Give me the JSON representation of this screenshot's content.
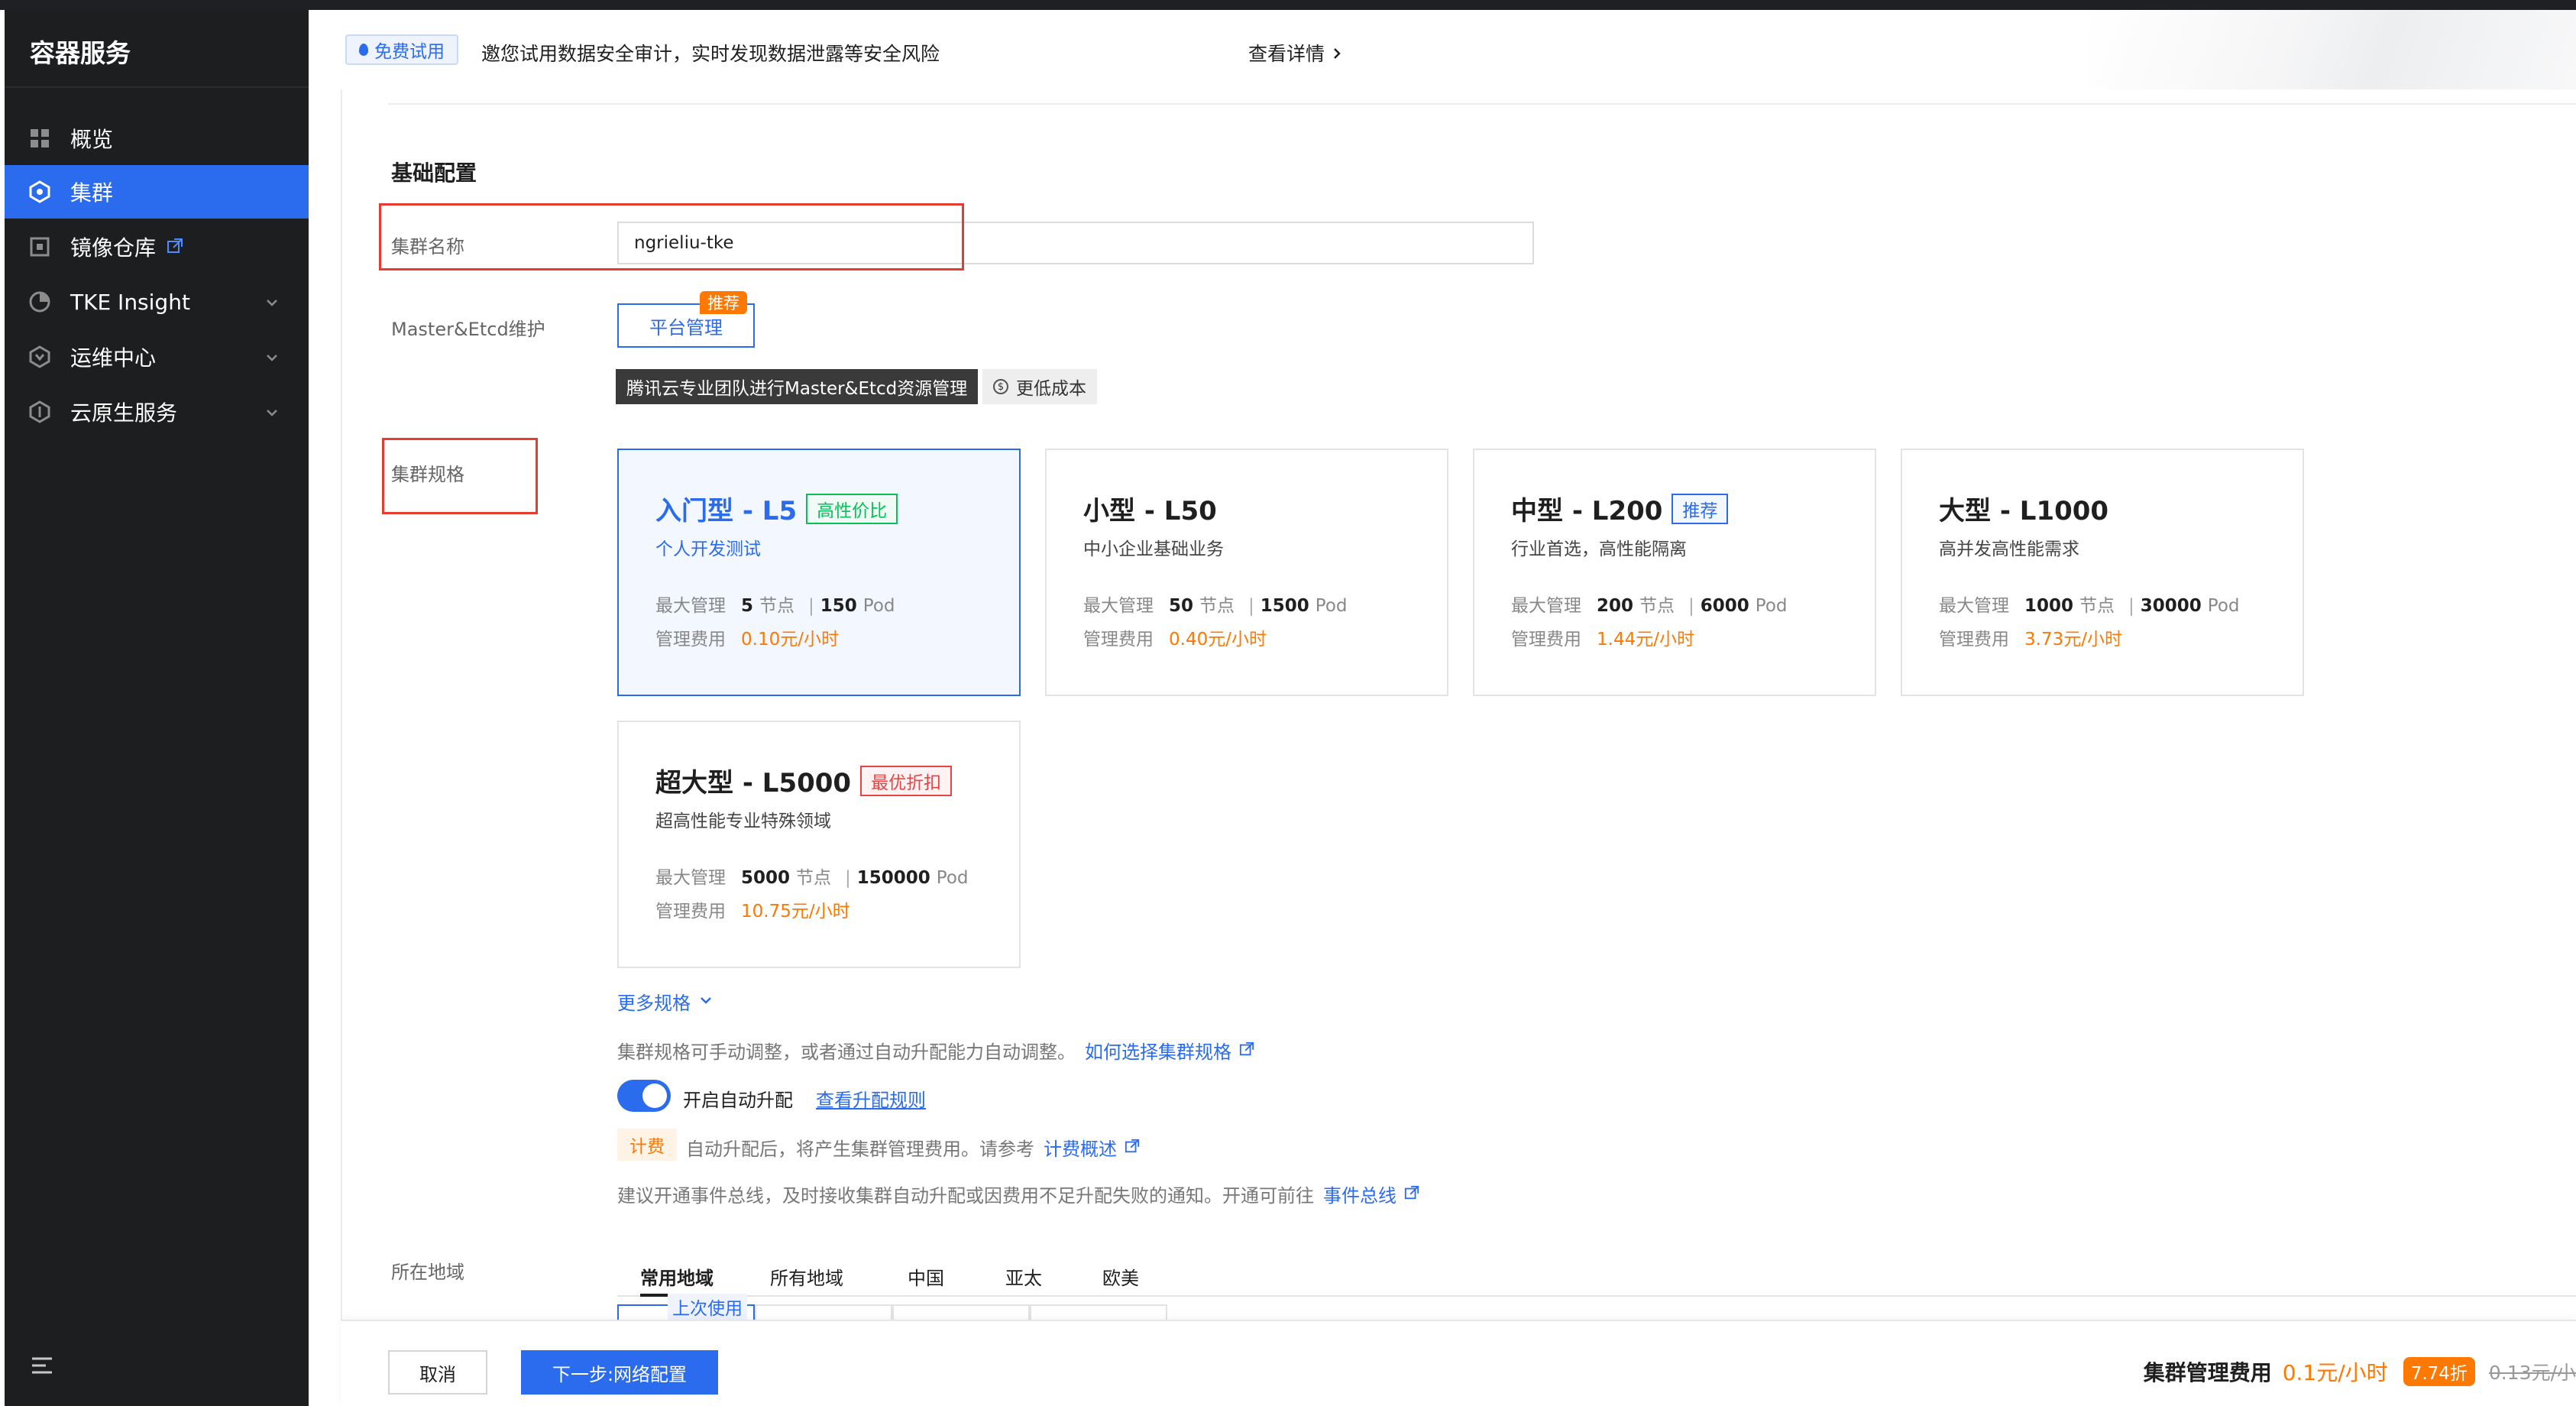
{
  "sidebar": {
    "title": "容器服务",
    "items": [
      {
        "label": "概览",
        "icon": "grid-icon"
      },
      {
        "label": "集群",
        "icon": "cluster-icon"
      },
      {
        "label": "镜像仓库",
        "icon": "image-repo-icon"
      },
      {
        "label": "TKE Insight",
        "icon": "insight-icon"
      },
      {
        "label": "运维中心",
        "icon": "ops-icon"
      },
      {
        "label": "云原生服务",
        "icon": "cloud-native-icon"
      }
    ]
  },
  "banner": {
    "badge": "免费试用",
    "text": "邀您试用数据安全审计，实时发现数据泄露等安全风险",
    "link": "查看详情"
  },
  "form": {
    "section_title": "基础配置",
    "cluster_name_label": "集群名称",
    "cluster_name_value": "ngrieliu-tke",
    "master_label": "Master&Etcd维护",
    "platform_button": "平台管理",
    "recommend_badge": "推荐",
    "tip_dark": "腾讯云专业团队进行Master&Etcd资源管理",
    "tip_light": "更低成本",
    "spec_label": "集群规格",
    "specs": [
      {
        "title": "入门型 - L5",
        "tag": "高性价比",
        "desc": "个人开发测试",
        "mgmt_label": "最大管理",
        "nodes": "5",
        "node_unit": "节点",
        "pods": "150",
        "pod_unit": "Pod",
        "fee_label": "管理费用",
        "price": "0.10元/小时"
      },
      {
        "title": "小型 - L50",
        "tag": "",
        "desc": "中小企业基础业务",
        "mgmt_label": "最大管理",
        "nodes": "50",
        "node_unit": "节点",
        "pods": "1500",
        "pod_unit": "Pod",
        "fee_label": "管理费用",
        "price": "0.40元/小时"
      },
      {
        "title": "中型 - L200",
        "tag": "推荐",
        "desc": "行业首选，高性能隔离",
        "mgmt_label": "最大管理",
        "nodes": "200",
        "node_unit": "节点",
        "pods": "6000",
        "pod_unit": "Pod",
        "fee_label": "管理费用",
        "price": "1.44元/小时"
      },
      {
        "title": "大型 - L1000",
        "tag": "",
        "desc": "高并发高性能需求",
        "mgmt_label": "最大管理",
        "nodes": "1000",
        "node_unit": "节点",
        "pods": "30000",
        "pod_unit": "Pod",
        "fee_label": "管理费用",
        "price": "3.73元/小时"
      },
      {
        "title": "超大型 - L5000",
        "tag": "最优折扣",
        "desc": "超高性能专业特殊领域",
        "mgmt_label": "最大管理",
        "nodes": "5000",
        "node_unit": "节点",
        "pods": "150000",
        "pod_unit": "Pod",
        "fee_label": "管理费用",
        "price": "10.75元/小时"
      }
    ],
    "more_specs": "更多规格",
    "spec_hint": "集群规格可手动调整，或者通过自动升配能力自动调整。",
    "spec_hint_link": "如何选择集群规格",
    "auto_upgrade_label": "开启自动升配",
    "auto_upgrade_on": true,
    "upgrade_rules_link": "查看升配规则",
    "billing_tag": "计费",
    "billing_text": "自动升配后，将产生集群管理费用。请参考",
    "billing_link": "计费概述",
    "event_hint": "建议开通事件总线，及时接收集群自动升配或因费用不足升配失败的通知。开通可前往",
    "event_link": "事件总线",
    "region_label": "所在地域",
    "region_tabs": [
      "常用地域",
      "所有地域",
      "中国",
      "亚太",
      "欧美"
    ],
    "last_used": "上次使用"
  },
  "footer": {
    "cancel": "取消",
    "next": "下一步:网络配置",
    "fee_label": "集群管理费用",
    "fee_price": "0.1元/小时",
    "discount": "7.74折",
    "original_price": "0.13元/小"
  },
  "colors": {
    "accent": "#2b6bee",
    "price": "#ff7800",
    "sidebar_bg": "#1d1e20",
    "highlight_box": "#e53c2f"
  }
}
